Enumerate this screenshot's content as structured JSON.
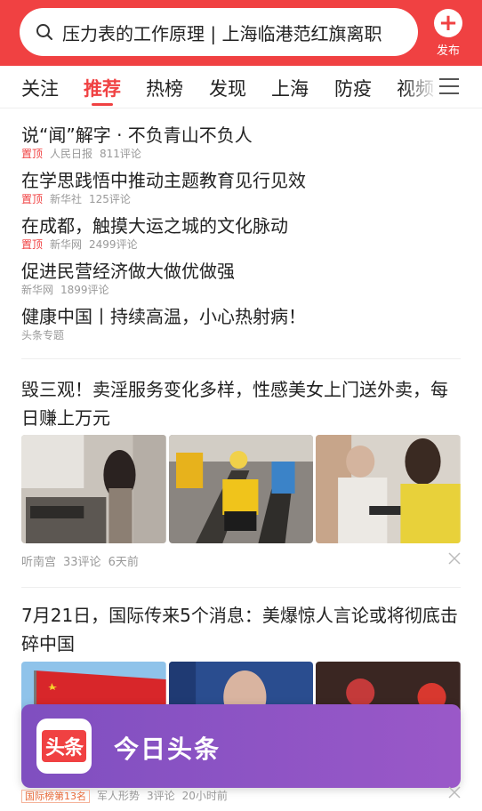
{
  "search": {
    "query": "压力表的工作原理 | 上海临港范红旗离职"
  },
  "publish": {
    "label": "发布"
  },
  "tabs": [
    "关注",
    "推荐",
    "热榜",
    "发现",
    "上海",
    "防疫",
    "视频"
  ],
  "active_tab": "推荐",
  "pinned": [
    {
      "title": "说“闻”解字 · 不负青山不负人",
      "tag": "置顶",
      "source": "人民日报",
      "comments": "811评论"
    },
    {
      "title": "在学思践悟中推动主题教育见行见效",
      "tag": "置顶",
      "source": "新华社",
      "comments": "125评论"
    },
    {
      "title": "在成都，触摸大运之城的文化脉动",
      "tag": "置顶",
      "source": "新华网",
      "comments": "2499评论"
    },
    {
      "title": "促进民营经济做大做优做强",
      "tag": "",
      "source": "新华网",
      "comments": "1899评论"
    },
    {
      "title": "健康中国丨持续高温，小心热射病！",
      "tag": "",
      "source": "头条专题",
      "comments": ""
    }
  ],
  "articles": [
    {
      "title": "毁三观！卖淫服务变化多样，性感美女上门送外卖，每日赚上万元",
      "source": "听南宫",
      "comments": "33评论",
      "time": "6天前"
    },
    {
      "title": "7月21日，国际传来5个消息：美爆惊人言论或将彻底击碎中国",
      "badge": "国际榜第13名",
      "source": "军人形势",
      "comments": "3评论",
      "time": "20小时前"
    }
  ],
  "banner": {
    "logo_text": "头条",
    "app_name": "今日头条"
  },
  "colors": {
    "brand_red": "#f04142",
    "banner_purple": "#8e55c5"
  }
}
